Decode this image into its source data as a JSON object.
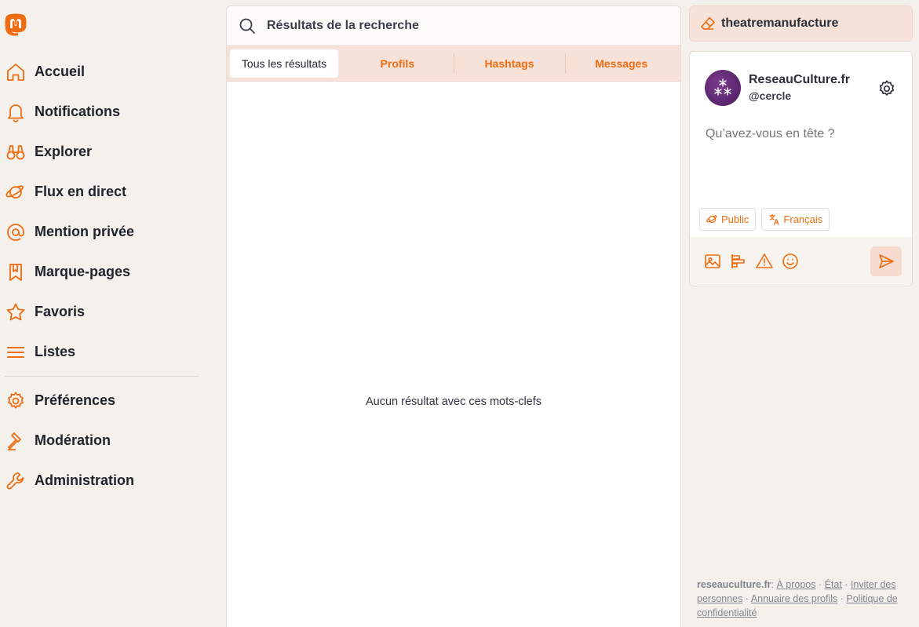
{
  "app": {
    "name": "Mastodon",
    "accent": "#ef6c10"
  },
  "sidebar": {
    "items": [
      {
        "label": "Accueil",
        "icon": "home-icon"
      },
      {
        "label": "Notifications",
        "icon": "bell-icon"
      },
      {
        "label": "Explorer",
        "icon": "binoculars-icon"
      },
      {
        "label": "Flux en direct",
        "icon": "planet-icon"
      },
      {
        "label": "Mention privée",
        "icon": "at-icon"
      },
      {
        "label": "Marque-pages",
        "icon": "bookmark-icon"
      },
      {
        "label": "Favoris",
        "icon": "star-icon"
      },
      {
        "label": "Listes",
        "icon": "list-icon"
      }
    ],
    "secondary": [
      {
        "label": "Préférences",
        "icon": "gear-icon"
      },
      {
        "label": "Modération",
        "icon": "gavel-icon"
      },
      {
        "label": "Administration",
        "icon": "wrench-icon"
      }
    ]
  },
  "search": {
    "title": "Résultats de la recherche"
  },
  "tabs": [
    {
      "label": "Tous les résultats",
      "active": true
    },
    {
      "label": "Profils",
      "active": false
    },
    {
      "label": "Hashtags",
      "active": false
    },
    {
      "label": "Messages",
      "active": false
    }
  ],
  "results": {
    "empty_message": "Aucun résultat avec ces mots-clefs"
  },
  "account_pill": {
    "label": "theatremanufacture"
  },
  "composer": {
    "display_name": "ReseauCulture.fr",
    "handle": "@cercle",
    "placeholder": "Qu’avez-vous en tête ?",
    "visibility": "Public",
    "language": "Français"
  },
  "footer": {
    "domain": "reseauculture.fr",
    "links": {
      "about": "À propos",
      "status": "État",
      "invite": "Inviter des personnes",
      "directory": "Annuaire des profils",
      "privacy": "Politique de confidentialité"
    }
  }
}
